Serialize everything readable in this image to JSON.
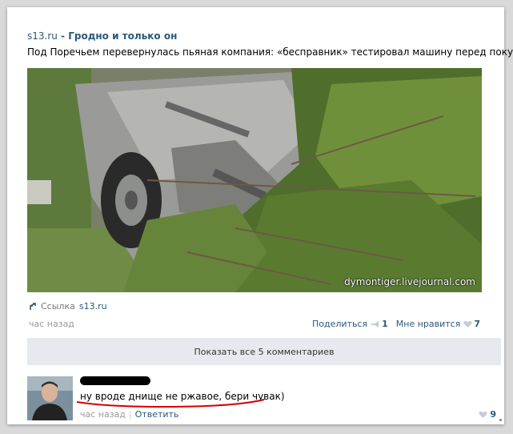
{
  "post": {
    "source_link": "s13.ru",
    "title_tail": " - Гродно и только он",
    "text": "Под Поречьем перевернулась пьяная компания: «бесправник» тестировал машину перед покупкой",
    "image_watermark": "dymontiger.livejournal.com",
    "link_label": "Ссылка",
    "link_domain": "s13.ru",
    "time": "час назад",
    "share_label": "Поделиться",
    "share_count": "1",
    "like_label": "Мне нравится",
    "like_count": "7"
  },
  "comments_bar": {
    "label": "Показать все 5 комментариев"
  },
  "comment": {
    "text": "ну вроде днище не ржавое, бери чувак)",
    "time": "час назад",
    "separator": "|",
    "reply_label": "Ответить",
    "like_count": "9"
  },
  "colors": {
    "link": "#2b587a",
    "underline": "#d40000",
    "bar_bg": "#e6eaee"
  },
  "icons": {
    "link": "arrow-icon",
    "share": "megaphone-icon",
    "like": "heart-icon"
  }
}
